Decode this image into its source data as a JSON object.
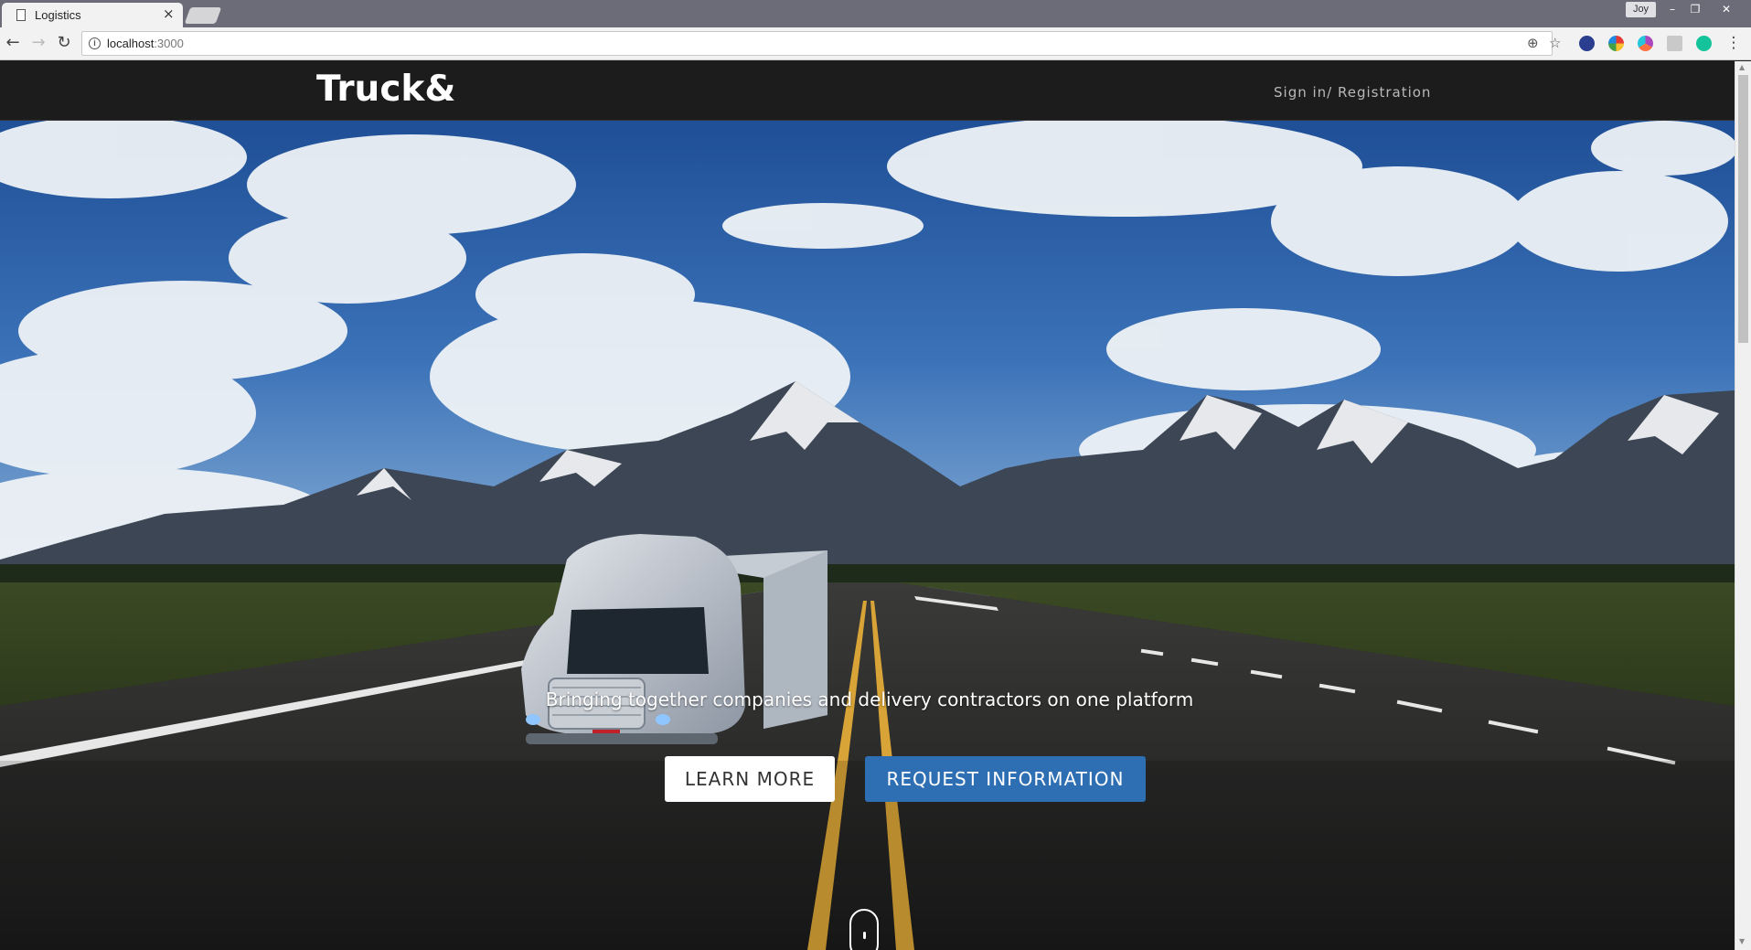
{
  "browser": {
    "tab_title": "Logistics",
    "tab_close": "×",
    "user_badge": "Joy",
    "window_buttons": {
      "minimize": "–",
      "restore": "❐",
      "close": "✕"
    },
    "nav": {
      "back": "←",
      "forward": "→",
      "reload": "↻"
    },
    "info_glyph": "i",
    "url_host": "localhost",
    "url_port": ":3000",
    "omnibox_icons": {
      "zoom": "⊕",
      "bookmark": "☆"
    },
    "menu_glyph": "⋮"
  },
  "site": {
    "logo": "Truck&",
    "nav_link": "Sign in/ Registration"
  },
  "hero": {
    "tagline": "Bringing together companies and delivery contractors on one platform",
    "learn_more": "LEARN MORE",
    "request_info": "REQUEST INFORMATION"
  },
  "colors": {
    "nav_bg": "#1c1c1c",
    "primary_button": "#2e6fb4",
    "sky": "#2a5fa6",
    "road": "#2a2a2a",
    "road_center_line": "#d9a437"
  },
  "icons": {
    "page": "page-icon",
    "info": "info-icon",
    "zoom": "zoom-icon",
    "bookmark": "star-icon",
    "menu": "more-icon",
    "scroll_indicator": "mouse-icon"
  }
}
